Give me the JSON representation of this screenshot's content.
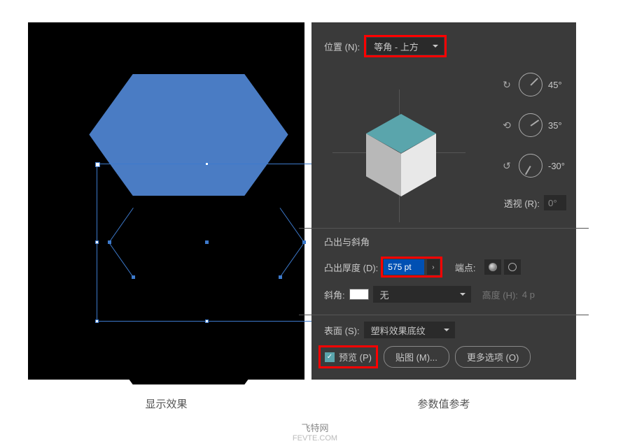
{
  "position": {
    "label": "位置 (N):",
    "value": "等角 - 上方"
  },
  "rotation": {
    "x": {
      "value": "45°",
      "angle": -45
    },
    "y": {
      "value": "35°",
      "angle": -10
    },
    "z": {
      "value": "-30°",
      "angle": 120
    }
  },
  "perspective": {
    "label": "透视 (R):",
    "value": "0°"
  },
  "extrude": {
    "section_title": "凸出与斜角",
    "depth_label": "凸出厚度 (D):",
    "depth_value": "575 pt",
    "cap_label": "端点:",
    "bevel_label": "斜角:",
    "bevel_value": "无",
    "height_label": "高度 (H):",
    "height_value": "4 p"
  },
  "surface": {
    "label": "表面 (S):",
    "value": "塑料效果底纹"
  },
  "buttons": {
    "preview": "预览 (P)",
    "map": "贴图 (M)...",
    "more": "更多选项 (O)"
  },
  "captions": {
    "left": "显示效果",
    "right": "参数值参考"
  },
  "footer": {
    "line1": "飞特网",
    "line2": "FEVTE.COM"
  }
}
